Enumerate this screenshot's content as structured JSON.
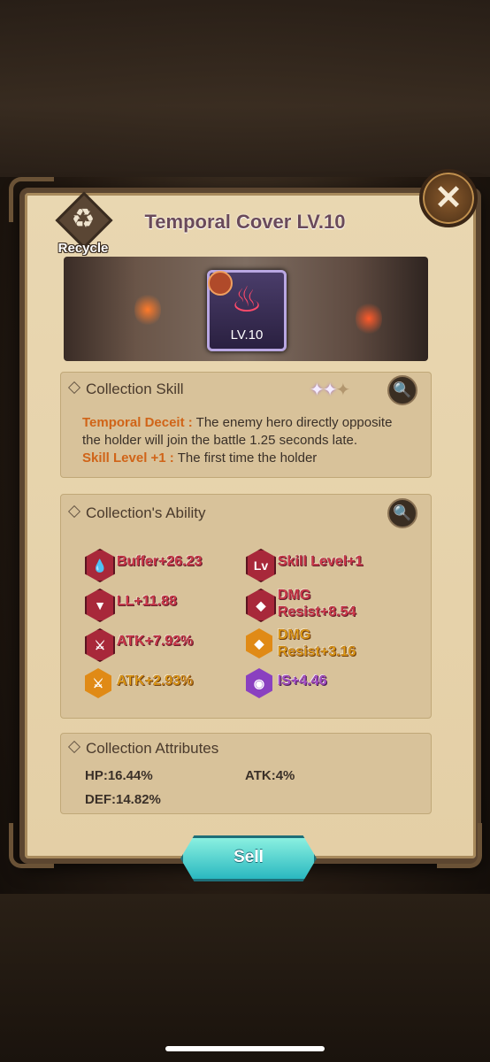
{
  "header": {
    "title": "Temporal Cover LV.10",
    "recycle_label": "Recycle",
    "close_symbol": "✕"
  },
  "item": {
    "level_label": "LV.10",
    "icon": "crimson-flame-relic-icon"
  },
  "collection_skill": {
    "title": "Collection Skill",
    "stars_filled": 2,
    "stars_total": 3,
    "desc_name": "Temporal Deceit :",
    "desc_text": " The enemy hero directly opposite the holder will join the battle 1.25 seconds late.",
    "next_name": "Skill Level +1 :",
    "next_text": " The first time the holder"
  },
  "collection_ability": {
    "title": "Collection's Ability",
    "items": [
      {
        "label": "Buffer+26.23",
        "color": "red",
        "icon": "drops-icon"
      },
      {
        "label": "Skill Level+1",
        "color": "red",
        "icon": "level-up-icon"
      },
      {
        "label": "LL+11.88",
        "color": "red",
        "icon": "fangs-icon"
      },
      {
        "label": "DMG Resist+8.54",
        "color": "red",
        "icon": "shield-icon"
      },
      {
        "label": "ATK+7.92%",
        "color": "red",
        "icon": "sword-icon"
      },
      {
        "label": "DMG Resist+3.16",
        "color": "gold",
        "icon": "shield-icon"
      },
      {
        "label": "ATK+2.93%",
        "color": "gold",
        "icon": "sword-icon"
      },
      {
        "label": "IS+4.46",
        "color": "purple",
        "icon": "eye-icon"
      }
    ]
  },
  "collection_attributes": {
    "title": "Collection Attributes",
    "hp": "HP:16.44%",
    "atk": "ATK:4%",
    "def": "DEF:14.82%"
  },
  "actions": {
    "sell_label": "Sell"
  },
  "colors": {
    "red": "#d4384a",
    "gold": "#e4a010",
    "purple": "#a650d0",
    "skill_name": "#d06418",
    "sell": "#2ab8c0"
  }
}
